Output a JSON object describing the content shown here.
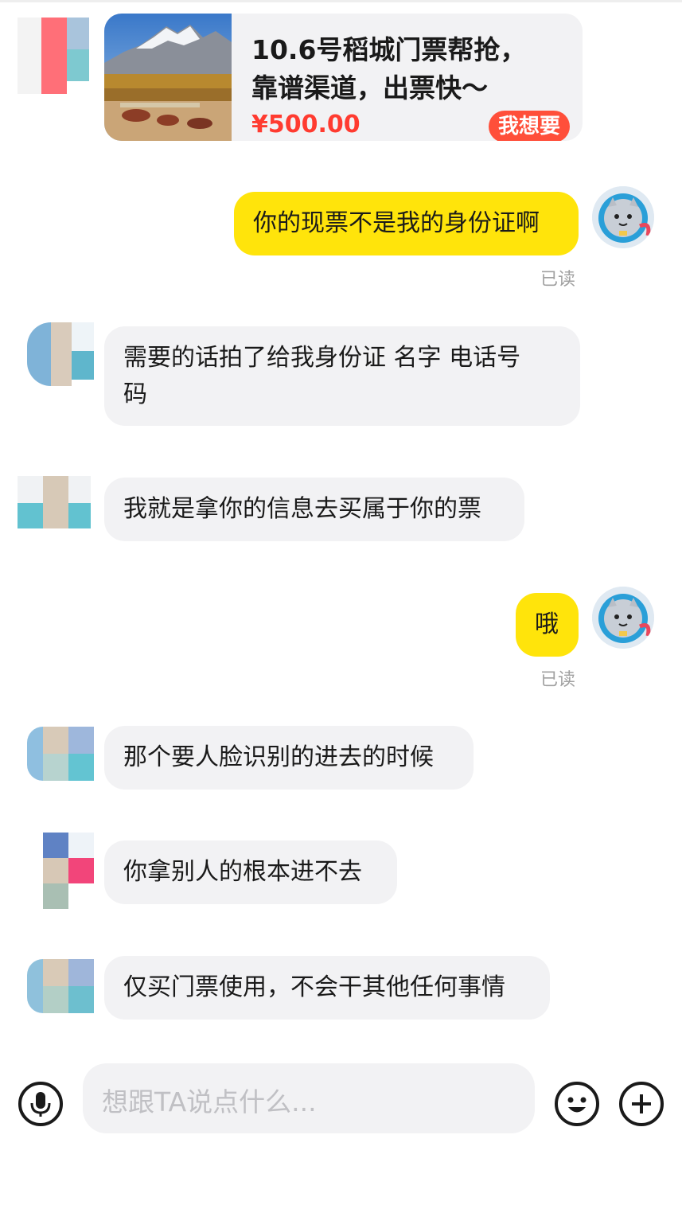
{
  "product_card": {
    "title_line1": "10.6号稻城门票帮抢，",
    "title_line2": "靠谱渠道，出票快～",
    "price": "¥500.00",
    "buy_label": "我想要"
  },
  "messages": [
    {
      "side": "out",
      "text": "你的现票不是我的身份证啊",
      "read": "已读"
    },
    {
      "side": "in",
      "text_line1": "需要的话拍了给我身份证 名字 电话号",
      "text_line2": "码"
    },
    {
      "side": "in",
      "text": "我就是拿你的信息去买属于你的票"
    },
    {
      "side": "out",
      "text": "哦",
      "read": "已读"
    },
    {
      "side": "in",
      "text": "那个要人脸识别的进去的时候"
    },
    {
      "side": "in",
      "text": "你拿别人的根本进不去"
    },
    {
      "side": "in",
      "text": "仅买门票使用，不会干其他任何事情"
    }
  ],
  "input": {
    "placeholder": "想跟TA说点什么..."
  },
  "icons": {
    "voice": "microphone-icon",
    "emoji": "smiley-icon",
    "more": "plus-icon"
  },
  "colors": {
    "outgoing_bubble": "#ffe40b",
    "incoming_bubble": "#f2f2f4",
    "price": "#ff3b30",
    "buy_button": "#ff4f3a"
  }
}
